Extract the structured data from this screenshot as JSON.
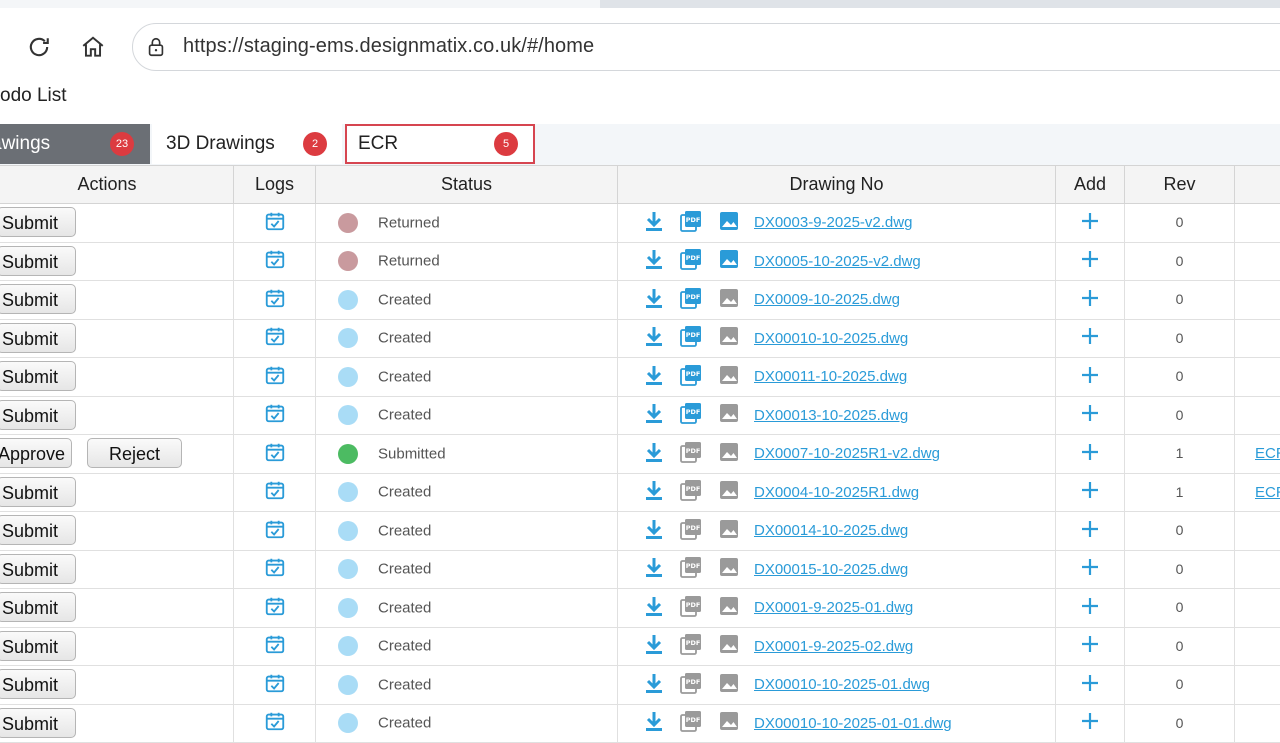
{
  "browser": {
    "url": "https://staging-ems.designmatix.co.uk/#/home",
    "icons": [
      "reload-icon",
      "home-icon",
      "lock-icon"
    ]
  },
  "page": {
    "title": "odo List"
  },
  "tabs": [
    {
      "label": "awings",
      "count": "23"
    },
    {
      "label": "3D Drawings",
      "count": "2"
    },
    {
      "label": "ECR",
      "count": "5"
    }
  ],
  "table": {
    "columns": {
      "actions": "Actions",
      "logs": "Logs",
      "status": "Status",
      "drawing_no": "Drawing No",
      "add": "Add",
      "rev": "Rev"
    },
    "rows": [
      {
        "actions": [
          "Submit"
        ],
        "status": "Returned",
        "drawing": "DX0003-9-2025-v2.dwg",
        "rev": "0",
        "extra": ""
      },
      {
        "actions": [
          "Submit"
        ],
        "status": "Returned",
        "drawing": "DX0005-10-2025-v2.dwg",
        "rev": "0",
        "extra": ""
      },
      {
        "actions": [
          "Submit"
        ],
        "status": "Created",
        "drawing": "DX0009-10-2025.dwg",
        "rev": "0",
        "extra": ""
      },
      {
        "actions": [
          "Submit"
        ],
        "status": "Created",
        "drawing": "DX00010-10-2025.dwg",
        "rev": "0",
        "extra": ""
      },
      {
        "actions": [
          "Submit"
        ],
        "status": "Created",
        "drawing": "DX00011-10-2025.dwg",
        "rev": "0",
        "extra": ""
      },
      {
        "actions": [
          "Submit"
        ],
        "status": "Created",
        "drawing": "DX00013-10-2025.dwg",
        "rev": "0",
        "extra": ""
      },
      {
        "actions": [
          "Approve",
          "Reject"
        ],
        "status": "Submitted",
        "drawing": "DX0007-10-2025R1-v2.dwg",
        "rev": "1",
        "extra": "ECR"
      },
      {
        "actions": [
          "Submit"
        ],
        "status": "Created",
        "drawing": "DX0004-10-2025R1.dwg",
        "rev": "1",
        "extra": "ECR"
      },
      {
        "actions": [
          "Submit"
        ],
        "status": "Created",
        "drawing": "DX00014-10-2025.dwg",
        "rev": "0",
        "extra": ""
      },
      {
        "actions": [
          "Submit"
        ],
        "status": "Created",
        "drawing": "DX00015-10-2025.dwg",
        "rev": "0",
        "extra": ""
      },
      {
        "actions": [
          "Submit"
        ],
        "status": "Created",
        "drawing": "DX0001-9-2025-01.dwg",
        "rev": "0",
        "extra": ""
      },
      {
        "actions": [
          "Submit"
        ],
        "status": "Created",
        "drawing": "DX0001-9-2025-02.dwg",
        "rev": "0",
        "extra": ""
      },
      {
        "actions": [
          "Submit"
        ],
        "status": "Created",
        "drawing": "DX00010-10-2025-01.dwg",
        "rev": "0",
        "extra": ""
      },
      {
        "actions": [
          "Submit"
        ],
        "status": "Created",
        "drawing": "DX00010-10-2025-01-01.dwg",
        "rev": "0",
        "extra": ""
      }
    ]
  },
  "row_icons": [
    "download-icon",
    "pdf-icon",
    "image-icon",
    "add-icon",
    "calendar-check-icon"
  ],
  "colors": {
    "accent": "#2a9bd8",
    "badge": "#dc3b40",
    "active_tab": "#6b6f75",
    "status_returned": "#c99a9e",
    "status_created": "#a9dcf6",
    "status_submitted": "#4cbb62",
    "icon_muted": "#9a9a9a"
  }
}
